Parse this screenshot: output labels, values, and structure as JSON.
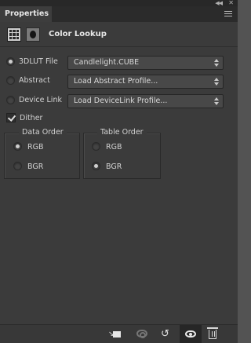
{
  "window": {
    "tab_label": "Properties"
  },
  "header": {
    "title": "Color Lookup",
    "icons": [
      "adjustment-grid-icon",
      "mask-icon"
    ]
  },
  "lookup": {
    "rows": [
      {
        "label": "3DLUT File",
        "value": "Candlelight.CUBE",
        "selected": true
      },
      {
        "label": "Abstract",
        "value": "Load Abstract Profile...",
        "selected": false
      },
      {
        "label": "Device Link",
        "value": "Load DeviceLink Profile...",
        "selected": false
      }
    ],
    "dither_label": "Dither",
    "dither_checked": true
  },
  "data_order": {
    "title": "Data Order",
    "options": [
      {
        "label": "RGB",
        "selected": true
      },
      {
        "label": "BGR",
        "selected": false
      }
    ]
  },
  "table_order": {
    "title": "Table Order",
    "options": [
      {
        "label": "RGB",
        "selected": false
      },
      {
        "label": "BGR",
        "selected": true
      }
    ]
  },
  "footer": {
    "icons": [
      "clip-to-layer-icon",
      "view-previous-state-icon",
      "reset-icon",
      "visibility-eye-icon",
      "trash-icon"
    ]
  },
  "colors": {
    "panel_bg": "#3b3b3b",
    "tab_bg": "#3d3d3d",
    "text": "#d2d2d2"
  }
}
